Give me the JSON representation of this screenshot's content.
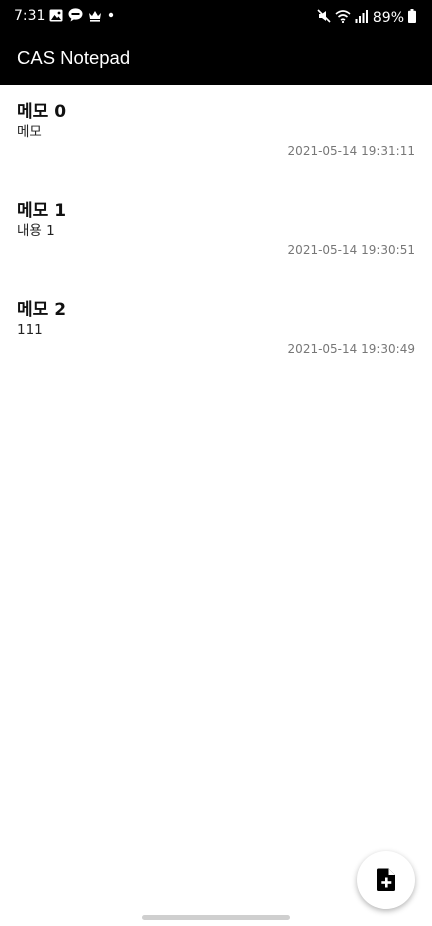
{
  "status_bar": {
    "time": "7:31",
    "battery": "89%",
    "left_icons": [
      "gallery-icon",
      "talk-icon",
      "crown-icon",
      "dot-icon"
    ],
    "right_icons": [
      "mute-icon",
      "wifi-icon",
      "signal-icon",
      "battery-icon"
    ]
  },
  "app_bar": {
    "title": "CAS Notepad"
  },
  "memos": [
    {
      "title": "메모 0",
      "content": "메모",
      "date": "2021-05-14 19:31:11"
    },
    {
      "title": "메모 1",
      "content": "내용 1",
      "date": "2021-05-14 19:30:51"
    },
    {
      "title": "메모 2",
      "content": "111",
      "date": "2021-05-14 19:30:49"
    }
  ],
  "fab": {
    "icon": "add-note-icon"
  },
  "colors": {
    "app_bar_background": "#000000",
    "page_background": "#ffffff",
    "date_text": "#777777"
  }
}
